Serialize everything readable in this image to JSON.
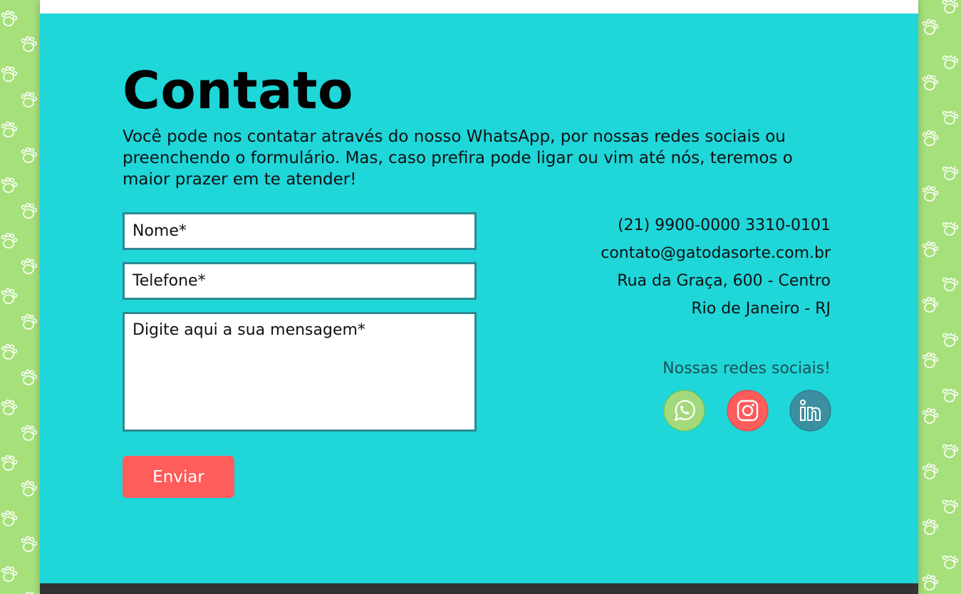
{
  "contact": {
    "title": "Contato",
    "intro": "Você pode nos contatar através do nosso WhatsApp, por nossas redes sociais ou preenchendo o formulário. Mas, caso prefira pode ligar ou vim até nós, teremos o maior prazer em te atender!"
  },
  "form": {
    "name_placeholder": "Nome*",
    "phone_placeholder": "Telefone*",
    "message_placeholder": "Digite aqui a sua mensagem*",
    "submit_label": "Enviar"
  },
  "info": {
    "phones": "(21) 9900-0000  3310-0101",
    "email": "contato@gatodasorte.com.br",
    "address": "Rua da Graça, 600 - Centro",
    "city": "Rio de Janeiro - RJ"
  },
  "social": {
    "title": "Nossas redes sociais!",
    "icons": [
      "whatsapp-icon",
      "instagram-icon",
      "linkedin-icon"
    ]
  },
  "colors": {
    "background_green": "#a6e07a",
    "section_turquoise": "#1fd6d9",
    "input_border": "#2a8a92",
    "button_red": "#ff5c5c",
    "whatsapp_green": "#a3d97a",
    "instagram_red": "#ff5c5c",
    "linkedin_teal": "#3b8fa0",
    "footer_dark": "#333333"
  }
}
